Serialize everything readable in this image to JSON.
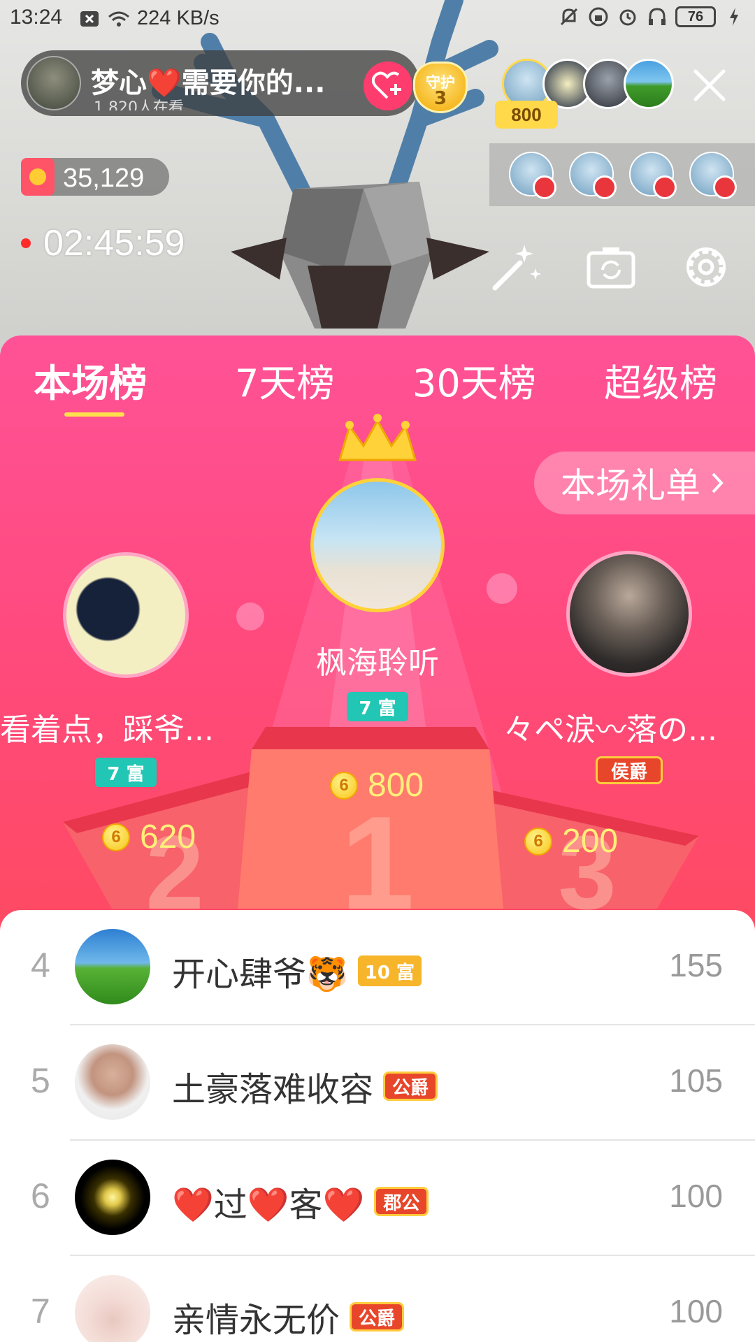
{
  "status_bar": {
    "time": "13:24",
    "net_speed": "224 KB/s",
    "battery": "76"
  },
  "host": {
    "name": "梦心❤️需要你的...",
    "viewers": "1,820人在看",
    "guard_label": "守护",
    "guard_count": "3"
  },
  "top_viewer_badge": "800",
  "coins": "35,129",
  "live_timer": "02:45:59",
  "tabs": [
    {
      "label": "本场榜",
      "active": true
    },
    {
      "label": "7天榜",
      "active": false
    },
    {
      "label": "30天榜",
      "active": false
    },
    {
      "label": "超级榜",
      "active": false
    }
  ],
  "gift_list_button": "本场礼单",
  "podium": {
    "first": {
      "name": "枫海聆听",
      "badge": "7 富",
      "coins": "800",
      "step_number": "1"
    },
    "second": {
      "name": "看着点，踩爷...",
      "badge": "7 富",
      "coins": "620",
      "step_number": "2"
    },
    "third": {
      "name": "々ペ涙〰落の...",
      "badge": "侯爵",
      "coins": "200",
      "step_number": "3"
    }
  },
  "ranking_list": [
    {
      "rank": "4",
      "name": "开心肆爷🐯",
      "badge": "10 富",
      "badge_type": "level",
      "score": "155"
    },
    {
      "rank": "5",
      "name": "土豪落难收容",
      "badge": "公爵",
      "badge_type": "noble",
      "score": "105"
    },
    {
      "rank": "6",
      "name": "❤️过❤️客❤️",
      "badge": "郡公",
      "badge_type": "noble",
      "score": "100"
    },
    {
      "rank": "7",
      "name": "亲情永无价",
      "badge": "公爵",
      "badge_type": "noble",
      "score": "100"
    }
  ],
  "colors": {
    "panel_top": "#ff5296",
    "panel_bottom": "#fb3f52",
    "coin_value": "#ffef7a",
    "rich_badge": "#22c6b4",
    "noble_badge": "#e8462a",
    "tab_underline": "#ffe14d"
  },
  "icons": {
    "follow": "heart-plus-icon",
    "close": "close-icon",
    "beauty": "magic-wand-icon",
    "camera_flip": "camera-flip-icon",
    "settings": "gear-icon",
    "seat": "sofa-icon",
    "crown": "crown-icon",
    "coin": "coin-icon"
  }
}
